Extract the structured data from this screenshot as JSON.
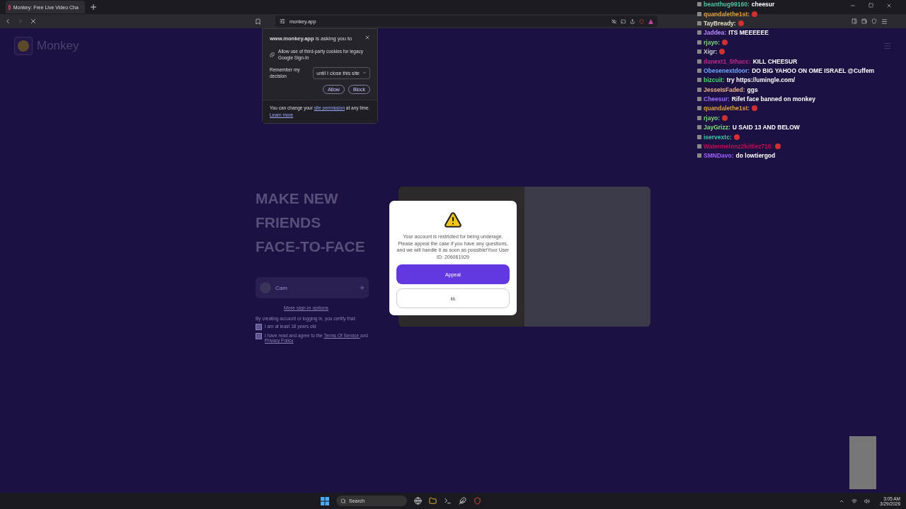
{
  "browser": {
    "tab_title": "Monkey: Free Live Video Cha",
    "address": "monkey.app"
  },
  "permission_popup": {
    "title": "**www.monkey.app** is asking you to",
    "request": "Allow use of third-party cookies for legacy Google Sign-In",
    "remember_label": "Remember my decision",
    "duration": "until I close this site",
    "buttons": [
      "Allow",
      "Block"
    ],
    "footer": "You can change your",
    "footer_link": "site permission",
    "footer_end": "at any time.",
    "learn_more": "Learn more"
  },
  "page": {
    "logo": "Monkey",
    "headline": [
      "MAKE NEW",
      "FRIENDS",
      "FACE-TO-FACE"
    ],
    "account_name": "Cam",
    "more_options": "More sign-in options",
    "certify": "By creating account or logging in, you certify that:",
    "checks": [
      {
        "checked": true,
        "parts": [
          {
            "kind": "text",
            "text": "I am at least 18 years old"
          }
        ]
      },
      {
        "checked": true,
        "parts": [
          {
            "kind": "text",
            "text": "I have read and agree to the"
          },
          {
            "kind": "link",
            "text": "Terms Of Service"
          },
          {
            "kind": "text",
            "text": "and"
          },
          {
            "kind": "link",
            "text": "Privacy Policy"
          }
        ]
      }
    ]
  },
  "modal": {
    "message": "Your account is restricted for being underage. Please appeal the case if you have any questions, and we will handle it as soon as possible!Your User ID:  206061929",
    "buttons": [
      {
        "label": "Appeal",
        "kind": "primary"
      },
      {
        "label": "kk",
        "kind": "secondary"
      }
    ]
  },
  "chat_separator": ":",
  "chat": [
    {
      "user": "beanthug99160",
      "color": "#4fc3a1",
      "kind": "text",
      "text": "cheesur"
    },
    {
      "user": "quandalethe1st",
      "color": "#e0a040",
      "kind": "emote"
    },
    {
      "user": "TayBready",
      "color": "#e6e0c8",
      "kind": "emote"
    },
    {
      "user": "Jaddea",
      "color": "#b48cff",
      "kind": "text",
      "text": "ITS MEEEEEE"
    },
    {
      "user": "rjayo",
      "color": "#7cd67c",
      "kind": "emote"
    },
    {
      "user": "Xigr",
      "color": "#d0d0d0",
      "kind": "emote"
    },
    {
      "user": "danext1_5thacc",
      "color": "#c0288a",
      "kind": "text",
      "text": "KILL CHEESUR"
    },
    {
      "user": "Obesenextdoor",
      "color": "#6fa8ff",
      "kind": "text",
      "text": "DO BIG YAHOO ON OME ISRAEL @Cuffem"
    },
    {
      "user": "bizcuit",
      "color": "#44dd66",
      "kind": "text",
      "text": "try https://umingle.com/"
    },
    {
      "user": "JesseIsFaded",
      "color": "#e8b080",
      "kind": "text",
      "text": "ggs"
    },
    {
      "user": "Cheesur",
      "color": "#a070ff",
      "kind": "text",
      "text": "Rifet face banned on monkey"
    },
    {
      "user": "quandalethe1st",
      "color": "#e0a040",
      "kind": "emote"
    },
    {
      "user": "rjayo",
      "color": "#7cd67c",
      "kind": "emote"
    },
    {
      "user": "JayGrizz",
      "color": "#7ee07e",
      "kind": "text",
      "text": "U SAID 13 AND BELOW"
    },
    {
      "user": "iservextc",
      "color": "#40c8a0",
      "kind": "emote"
    },
    {
      "user": "Watermelonz2kittlez716",
      "color": "#c01050",
      "kind": "emote"
    },
    {
      "user": "SMNDavo",
      "color": "#a060ff",
      "kind": "text",
      "text": "do lowtiergod"
    }
  ],
  "taskbar": {
    "search": "Search",
    "time": "3:05 AM",
    "date": "3/29/2026"
  }
}
